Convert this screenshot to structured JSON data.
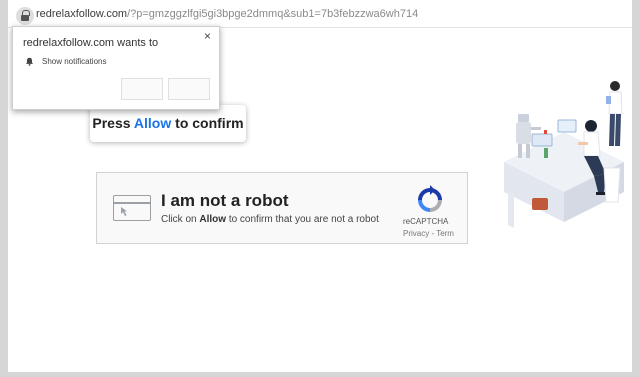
{
  "address": {
    "domain": "redrelaxfollow.com",
    "query": "/?p=gmzggzlfgi5gi3bpge2dmmq&sub1=7b3febzzwa6wh714"
  },
  "notification": {
    "title": "redrelaxfollow.com wants to",
    "permission": "Show notifications",
    "close": "×"
  },
  "press": {
    "prefix": "Press",
    "allow": "Allow",
    "suffix": "to confirm"
  },
  "captcha": {
    "heading": "I am not a robot",
    "desc_prefix": "Click on",
    "desc_bold": "Allow",
    "desc_suffix": "to confirm that you are not a robot",
    "brand": "reCAPTCHA",
    "links": "Privacy - Term"
  },
  "colors": {
    "accent": "#1a73e8",
    "background": "#ffffff",
    "captcha_bg": "#f9f9f9"
  }
}
